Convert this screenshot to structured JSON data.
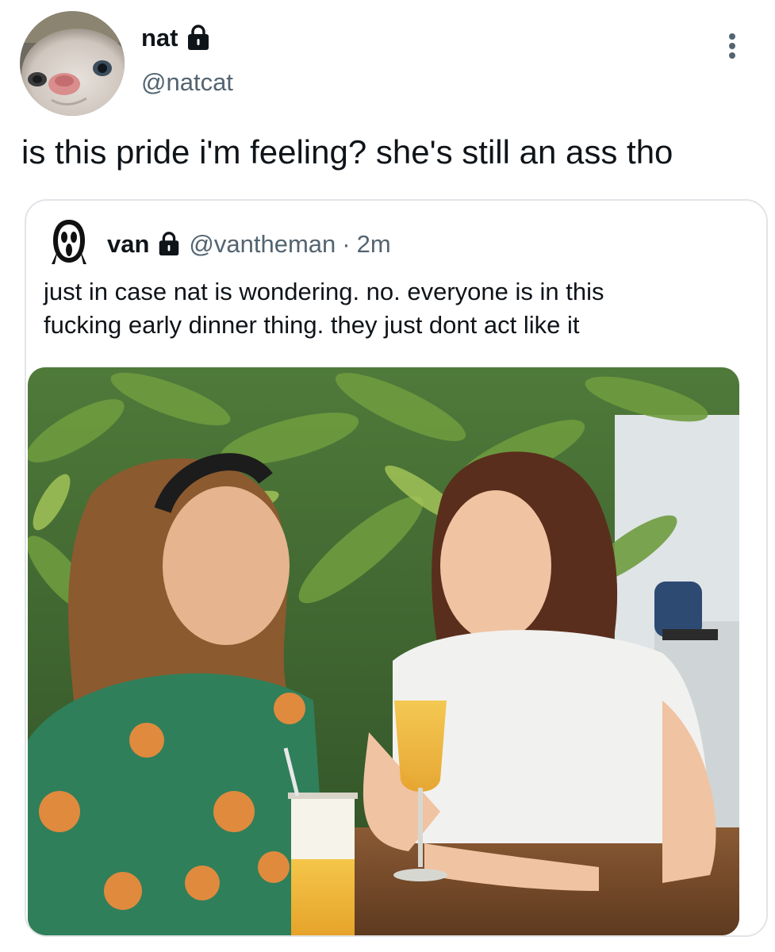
{
  "tweet": {
    "display_name": "nat",
    "handle": "@natcat",
    "text": "is this pride i'm feeling? she's still an ass tho"
  },
  "quoted_tweet": {
    "display_name": "van",
    "handle": "@vantheman",
    "separator": "·",
    "time": "2m",
    "text_lines": [
      "just in case nat is wondering. no. everyone is in this",
      "fucking early dinner thing. they just dont act like it"
    ]
  },
  "icons": {
    "lock": "lock-icon",
    "more": "more-vertical-icon",
    "quote_avatar": "ghostface-mask-icon",
    "avatar": "cat-avatar"
  },
  "colors": {
    "primary_text": "#0f1419",
    "secondary_text": "#536471",
    "border": "#e1e4e8"
  }
}
